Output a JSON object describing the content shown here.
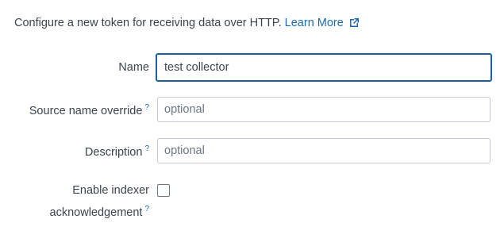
{
  "intro": {
    "text": "Configure a new token for receiving data over HTTP.",
    "learn_more_label": "Learn More"
  },
  "form": {
    "name": {
      "label": "Name",
      "value": "test collector"
    },
    "source_name_override": {
      "label": "Source name override",
      "help": "?",
      "placeholder": "optional"
    },
    "description": {
      "label": "Description",
      "help": "?",
      "placeholder": "optional"
    },
    "indexer_ack": {
      "label_line1": "Enable indexer",
      "label_line2": "acknowledgement",
      "help": "?",
      "checked": false
    }
  },
  "colors": {
    "text": "#3c444d",
    "link": "#1a6aaf",
    "focus_border": "#1a5ea5",
    "input_border": "#c3cbd4"
  },
  "icons": {
    "learn_more": "external-link-icon"
  }
}
